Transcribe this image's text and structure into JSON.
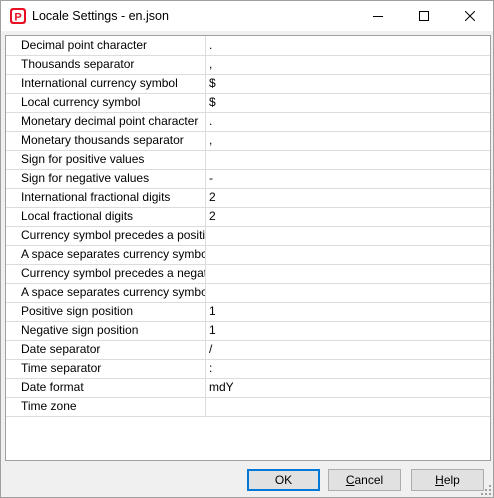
{
  "window": {
    "title": "Locale Settings - en.json",
    "app_icon_letter": "P",
    "accent_color": "#e81123"
  },
  "rows": [
    {
      "label": "Decimal point character",
      "value": "."
    },
    {
      "label": "Thousands separator",
      "value": ","
    },
    {
      "label": "International currency symbol",
      "value": "$"
    },
    {
      "label": "Local currency symbol",
      "value": "$"
    },
    {
      "label": "Monetary decimal point character",
      "value": "."
    },
    {
      "label": "Monetary thousands separator",
      "value": ","
    },
    {
      "label": "Sign for positive values",
      "value": ""
    },
    {
      "label": "Sign for negative values",
      "value": "-"
    },
    {
      "label": "International fractional digits",
      "value": "2"
    },
    {
      "label": "Local fractional digits",
      "value": "2"
    },
    {
      "label": "Currency symbol precedes a positive v",
      "checked": true
    },
    {
      "label": "A space separates currency symbol fr",
      "checked": false
    },
    {
      "label": "Currency symbol precedes a negative",
      "checked": true
    },
    {
      "label": "A space separates currency symbol fr",
      "checked": false
    },
    {
      "label": "Positive sign position",
      "value": "1"
    },
    {
      "label": "Negative sign position",
      "value": "1"
    },
    {
      "label": "Date separator",
      "value": "/"
    },
    {
      "label": "Time separator",
      "value": ":"
    },
    {
      "label": "Date format",
      "value": "mdY"
    },
    {
      "label": "Time zone",
      "value": ""
    }
  ],
  "buttons": {
    "ok": "OK",
    "cancel_rest": "ancel",
    "cancel_mn": "C",
    "help_mn": "H",
    "help_rest": "elp"
  }
}
